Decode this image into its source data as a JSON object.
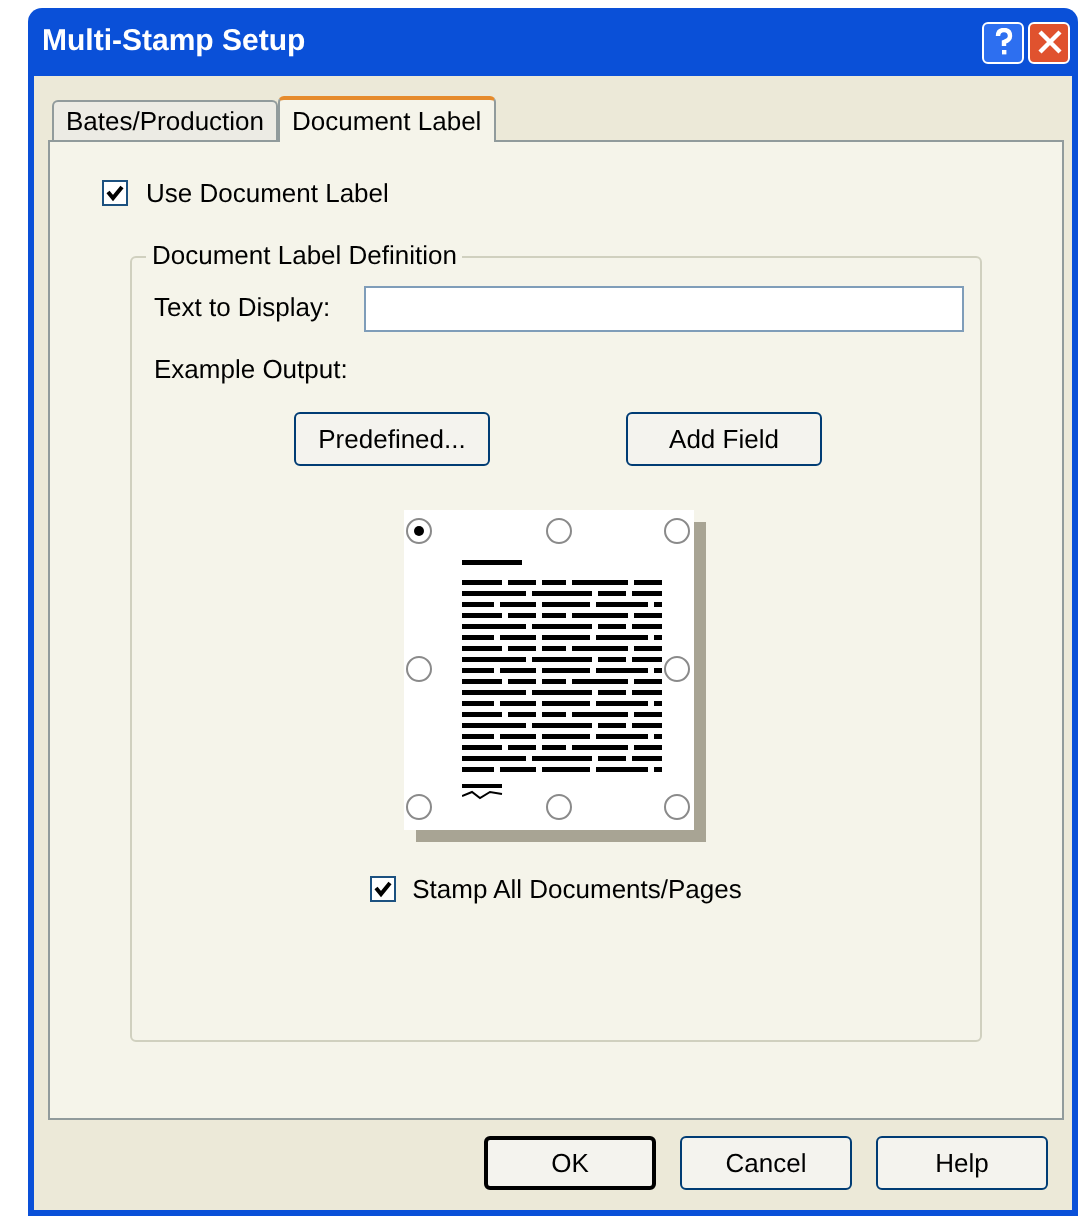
{
  "window": {
    "title": "Multi-Stamp Setup"
  },
  "tabs": [
    {
      "label": "Bates/Production",
      "selected": false
    },
    {
      "label": "Document Label",
      "selected": true
    }
  ],
  "use_document_label": {
    "label": "Use Document Label",
    "checked": true
  },
  "group": {
    "title": "Document Label Definition",
    "text_to_display": {
      "label": "Text to Display:"
    },
    "example_output_label": "Example Output:",
    "buttons": [
      "Predefined...",
      "Add Field"
    ],
    "positions": [
      {
        "selected": true
      },
      {
        "selected": false
      },
      {
        "selected": false
      },
      {
        "selected": false
      },
      {
        "selected": false
      },
      {
        "selected": false
      },
      {
        "selected": false
      },
      {
        "selected": false
      }
    ],
    "stamp_all": {
      "label": "Stamp All Documents/Pages",
      "checked": true
    }
  },
  "buttons": [
    {
      "label": "OK",
      "default": true
    },
    {
      "label": "Cancel",
      "default": false
    },
    {
      "label": "Help",
      "default": false
    }
  ]
}
